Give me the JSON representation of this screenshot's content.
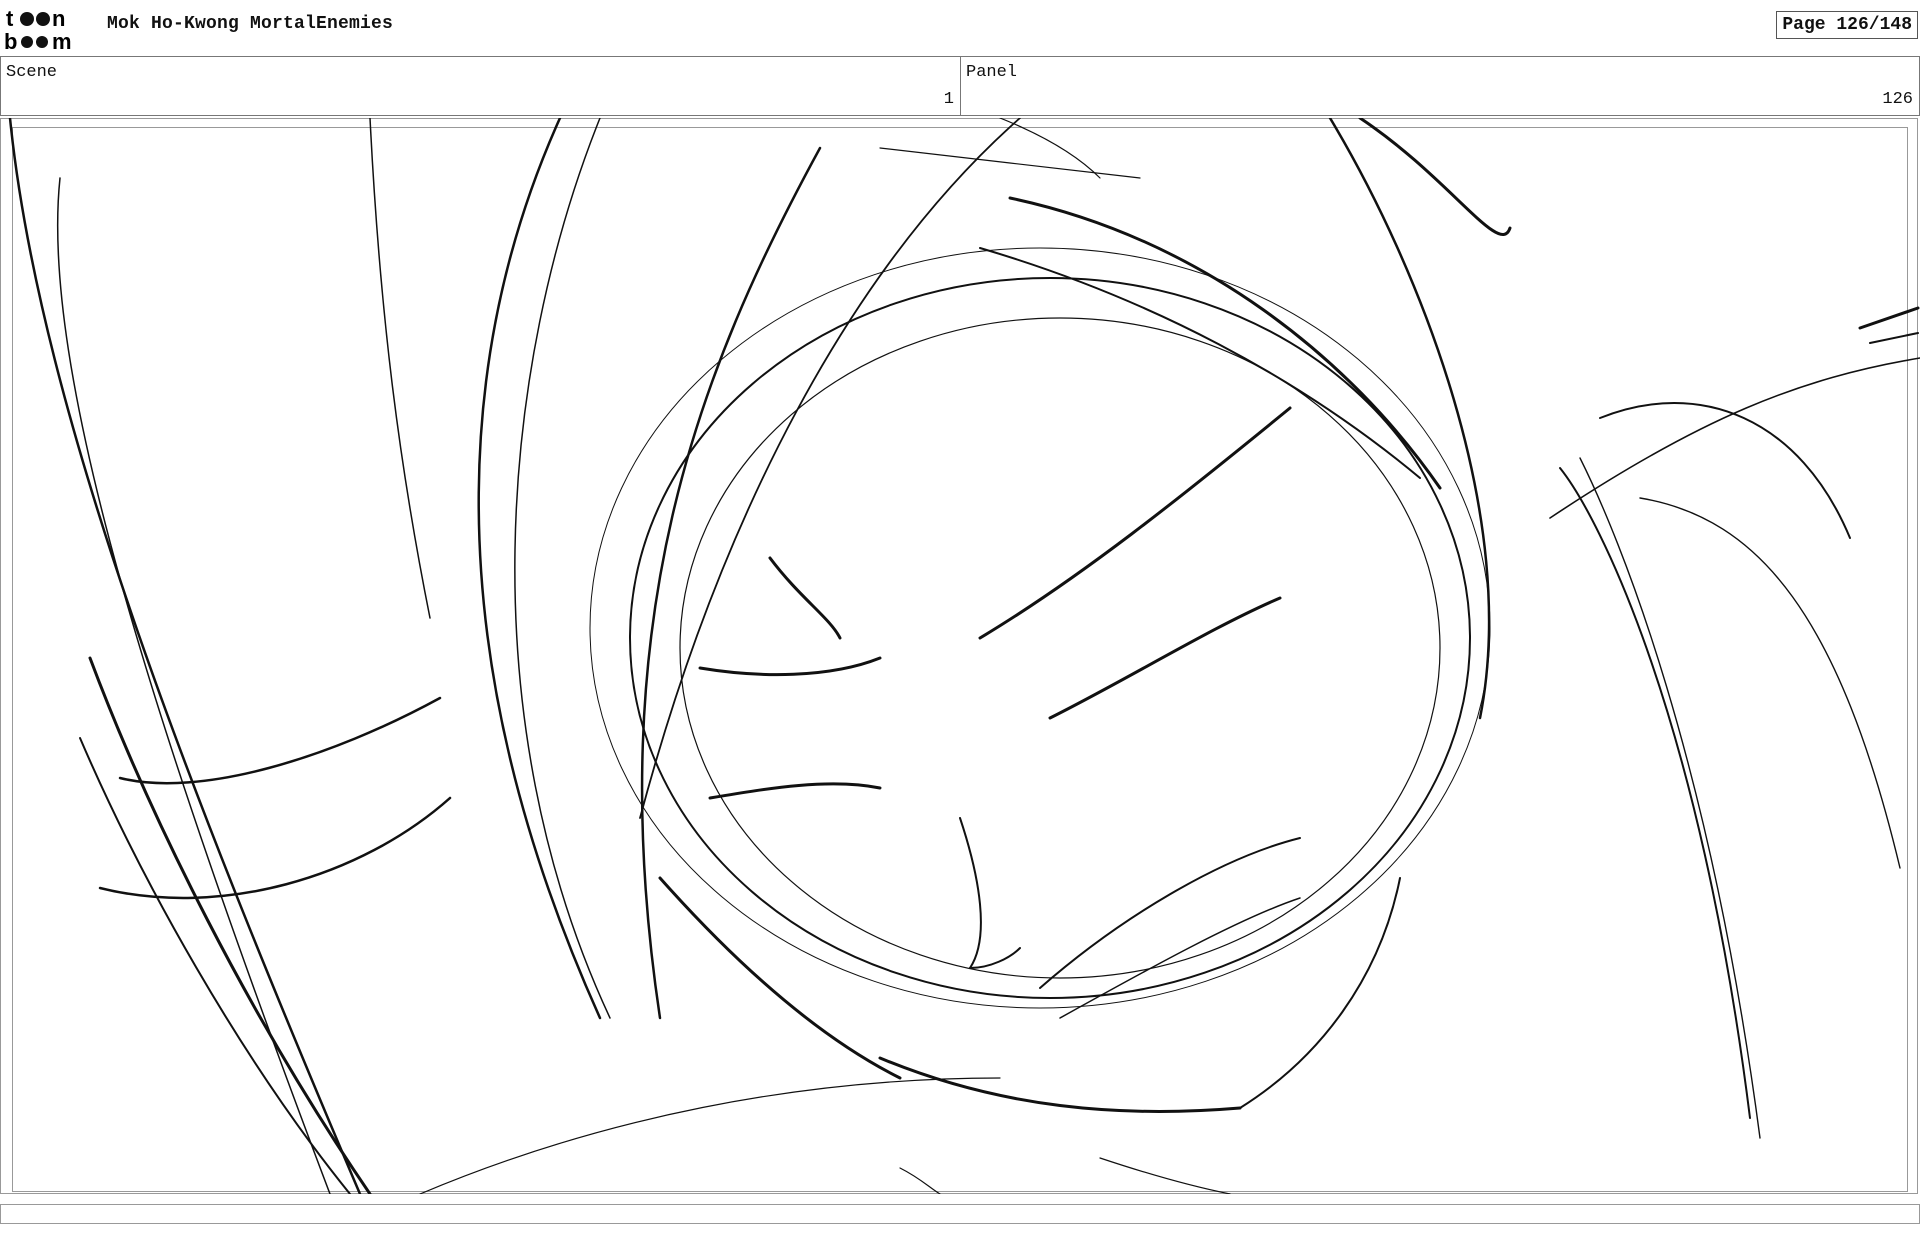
{
  "header": {
    "logo_top": "toon",
    "logo_bottom": "boom",
    "project_title": "Mok Ho-Kwong MortalEnemies",
    "page_indicator": "Page 126/148"
  },
  "info": {
    "scene_label": "Scene",
    "scene_value": "1",
    "panel_label": "Panel",
    "panel_value": "126"
  },
  "panel": {
    "icon": "sketch-drawing",
    "stroke_color": "#111111"
  }
}
